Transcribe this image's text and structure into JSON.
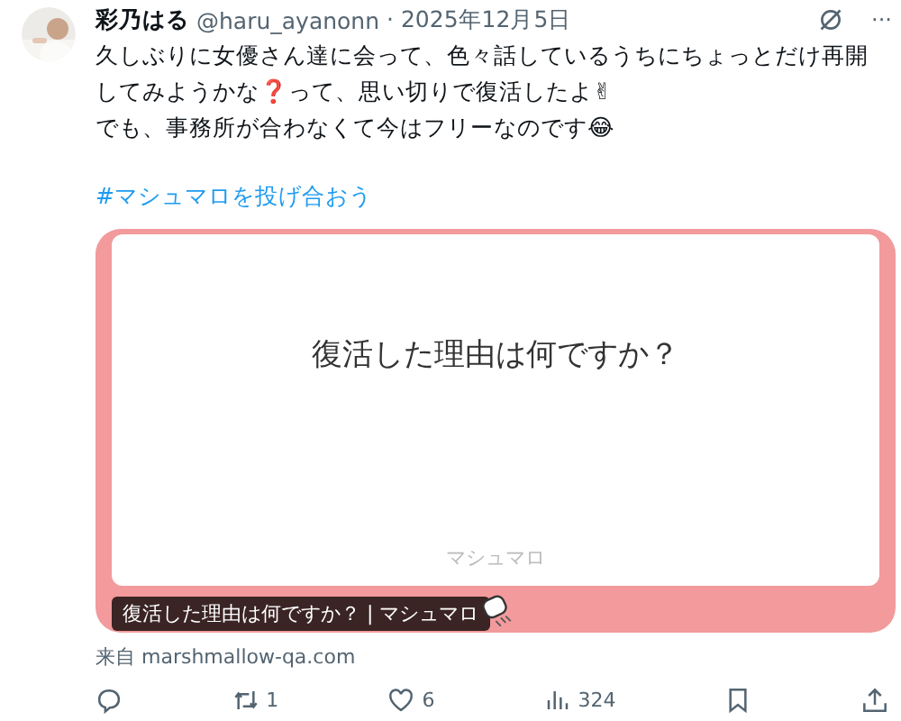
{
  "post": {
    "author": "彩乃はる",
    "handle": "@haru_ayanonn",
    "date": "· 2025年12月5日",
    "more": "···",
    "lines": [
      "久しぶりに女優さん達に会って、色々話しているうちにちょっとだけ再開してみようかな❓って、思い切りで復活したよ✌",
      "でも、事務所が合わなくて今はフリーなのです😂"
    ],
    "hashtag": "#マシュマロを投げ合おう"
  },
  "card": {
    "question": "復活した理由は何ですか？",
    "brand": "マシュマロ",
    "caption": "復活した理由は何ですか？ | マシュマロ"
  },
  "source": "来自 marshmallow-qa.com",
  "actions": [
    {
      "kind": "reply"
    },
    {
      "kind": "repost",
      "count": "1"
    },
    {
      "kind": "like",
      "count": "6"
    },
    {
      "kind": "views",
      "count": "324"
    },
    {
      "kind": "bookmark"
    },
    {
      "kind": "share"
    }
  ]
}
